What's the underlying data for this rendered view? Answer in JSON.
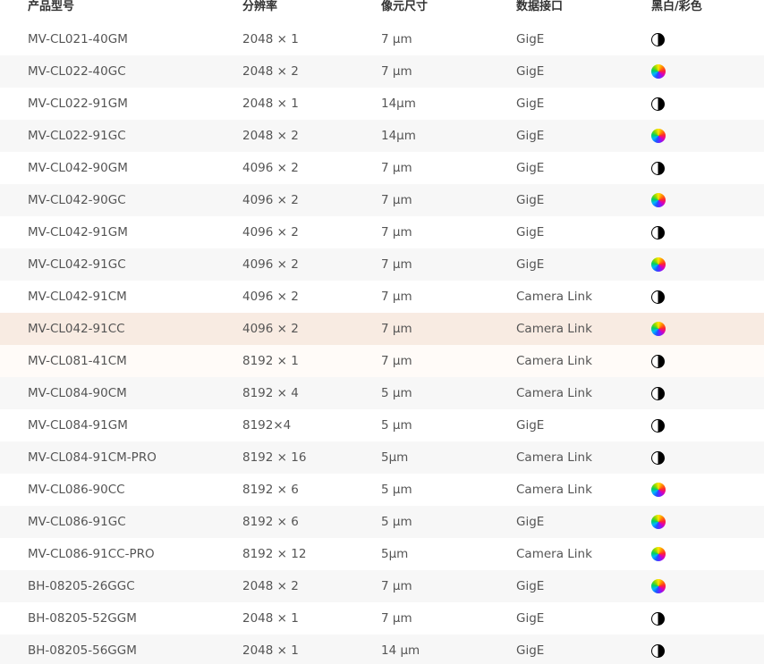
{
  "headers": {
    "model": "产品型号",
    "resolution": "分辨率",
    "pixel_size": "像元尺寸",
    "interface": "数据接口",
    "mono_color": "黑白/彩色"
  },
  "rows": [
    {
      "model": "MV-CL021-40GM",
      "resolution": "2048 × 1",
      "pixel_size": "7 μm",
      "interface": "GigE",
      "type": "mono"
    },
    {
      "model": "MV-CL022-40GC",
      "resolution": "2048 × 2",
      "pixel_size": "7 μm",
      "interface": "GigE",
      "type": "color"
    },
    {
      "model": "MV-CL022-91GM",
      "resolution": "2048 × 1",
      "pixel_size": "14μm",
      "interface": "GigE",
      "type": "mono"
    },
    {
      "model": "MV-CL022-91GC",
      "resolution": "2048 × 2",
      "pixel_size": "14μm",
      "interface": "GigE",
      "type": "color"
    },
    {
      "model": "MV-CL042-90GM",
      "resolution": "4096 × 2",
      "pixel_size": "7 μm",
      "interface": "GigE",
      "type": "mono"
    },
    {
      "model": "MV-CL042-90GC",
      "resolution": "4096 × 2",
      "pixel_size": "7 μm",
      "interface": "GigE",
      "type": "color"
    },
    {
      "model": "MV-CL042-91GM",
      "resolution": "4096 × 2",
      "pixel_size": "7 μm",
      "interface": "GigE",
      "type": "mono"
    },
    {
      "model": "MV-CL042-91GC",
      "resolution": "4096 × 2",
      "pixel_size": "7 μm",
      "interface": "GigE",
      "type": "color"
    },
    {
      "model": "MV-CL042-91CM",
      "resolution": "4096 × 2",
      "pixel_size": "7 μm",
      "interface": "Camera Link",
      "type": "mono"
    },
    {
      "model": "MV-CL042-91CC",
      "resolution": "4096 × 2",
      "pixel_size": "7 μm",
      "interface": "Camera Link",
      "type": "color"
    },
    {
      "model": "MV-CL081-41CM",
      "resolution": "8192 × 1",
      "pixel_size": "7 μm",
      "interface": "Camera Link",
      "type": "mono"
    },
    {
      "model": "MV-CL084-90CM",
      "resolution": "8192 × 4",
      "pixel_size": "5 μm",
      "interface": "Camera Link",
      "type": "mono"
    },
    {
      "model": "MV-CL084-91GM",
      "resolution": "8192×4",
      "pixel_size": "5 μm",
      "interface": "GigE",
      "type": "mono"
    },
    {
      "model": "MV-CL084-91CM-PRO",
      "resolution": "8192 × 16",
      "pixel_size": "5μm",
      "interface": "Camera Link",
      "type": "mono"
    },
    {
      "model": "MV-CL086-90CC",
      "resolution": "8192 × 6",
      "pixel_size": "5 μm",
      "interface": "Camera Link",
      "type": "color"
    },
    {
      "model": "MV-CL086-91GC",
      "resolution": "8192 × 6",
      "pixel_size": "5 μm",
      "interface": "GigE",
      "type": "color"
    },
    {
      "model": "MV-CL086-91CC-PRO",
      "resolution": "8192 × 12",
      "pixel_size": "5μm",
      "interface": "Camera Link",
      "type": "color"
    },
    {
      "model": "BH-08205-26GGC",
      "resolution": "2048 × 2",
      "pixel_size": "7 μm",
      "interface": "GigE",
      "type": "color"
    },
    {
      "model": "BH-08205-52GGM",
      "resolution": "2048 × 1",
      "pixel_size": "7 μm",
      "interface": "GigE",
      "type": "mono"
    },
    {
      "model": "BH-08205-56GGM",
      "resolution": "2048 × 1",
      "pixel_size": "14 μm",
      "interface": "GigE",
      "type": "mono"
    }
  ],
  "highlighted_row": 9,
  "colors": {
    "text": "#555555",
    "header_text": "#333333",
    "stripe": "#f7f7f7",
    "highlight": "#f8ebe2"
  },
  "icons": {
    "mono": "half-filled-circle-icon",
    "color": "color-wheel-icon"
  }
}
